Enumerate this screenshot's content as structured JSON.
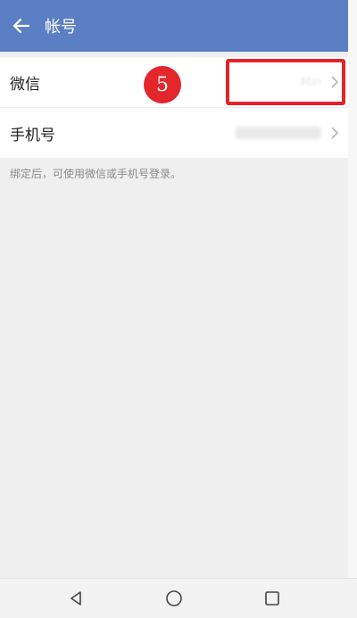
{
  "appbar": {
    "title": "帐号",
    "back_icon": "back-arrow-icon",
    "color": "#5a7fc4"
  },
  "rows": [
    {
      "label": "微信",
      "value": "Min"
    },
    {
      "label": "手机号",
      "value": ""
    }
  ],
  "hint": "绑定后，可使用微信或手机号登录。",
  "annotation": {
    "step": "5",
    "color": "#e3262c"
  },
  "navbar": {
    "back_icon": "nav-back-icon",
    "home_icon": "nav-home-icon",
    "recents_icon": "nav-recents-icon"
  }
}
